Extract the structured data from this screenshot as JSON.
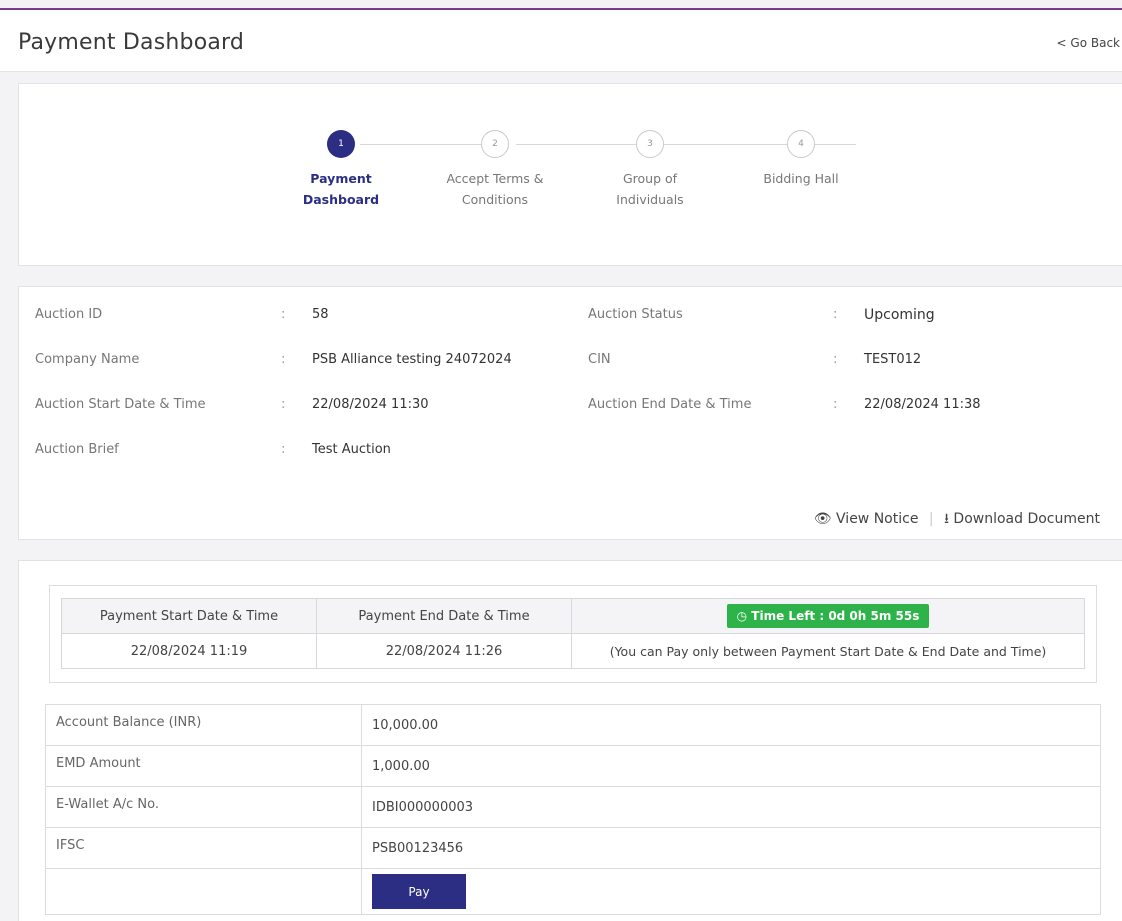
{
  "header": {
    "title": "Payment Dashboard",
    "go_back": "< Go Back"
  },
  "steps": [
    {
      "number": "1",
      "label": "Payment Dashboard",
      "active": true
    },
    {
      "number": "2",
      "label": "Accept Terms & Conditions",
      "active": false
    },
    {
      "number": "3",
      "label": "Group of Individuals",
      "active": false
    },
    {
      "number": "4",
      "label": "Bidding Hall",
      "active": false
    }
  ],
  "auction": {
    "auction_id_label": "Auction ID",
    "auction_id": "58",
    "status_label": "Auction Status",
    "status": "Upcoming",
    "company_label": "Company Name",
    "company": "PSB Alliance testing 24072024",
    "cin_label": "CIN",
    "cin": "TEST012",
    "start_label": "Auction Start Date & Time",
    "start": "22/08/2024 11:30",
    "end_label": "Auction End Date & Time",
    "end": "22/08/2024 11:38",
    "brief_label": "Auction Brief",
    "brief": "Test Auction",
    "colon": ":"
  },
  "documents": {
    "view_notice": "View Notice",
    "separator": "|",
    "download": "Download Document"
  },
  "payment_window": {
    "start_header": "Payment Start Date & Time",
    "end_header": "Payment End Date & Time",
    "time_left": "Time Left : 0d 0h 5m 55s",
    "start": "22/08/2024 11:19",
    "end": "22/08/2024 11:26",
    "note": "(You can Pay only between Payment Start Date & End Date and Time)"
  },
  "account": {
    "balance_label": "Account Balance (INR)",
    "balance": "10,000.00",
    "emd_label": "EMD Amount",
    "emd": "1,000.00",
    "wallet_label": "E-Wallet A/c No.",
    "wallet": "IDBI000000003",
    "ifsc_label": "IFSC",
    "ifsc": "PSB00123456",
    "pay_button": "Pay"
  },
  "colors": {
    "primary": "#2b2e83",
    "success": "#2db34a",
    "top_accent": "#7a3d8c"
  }
}
